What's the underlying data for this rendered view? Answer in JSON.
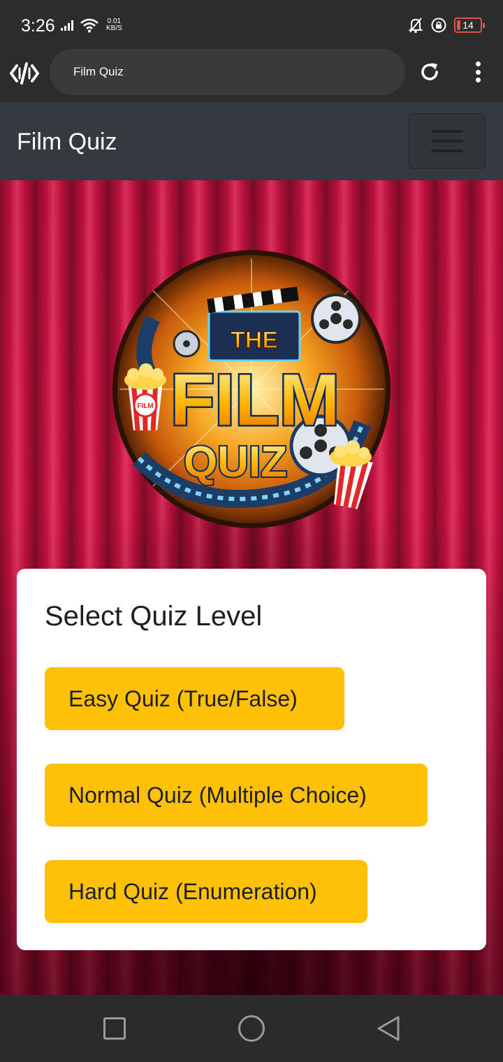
{
  "status_bar": {
    "time": "3:26",
    "net_speed_value": "0.01",
    "net_speed_unit": "KB/S",
    "battery_level": "14",
    "battery_color": "#e05050"
  },
  "browser": {
    "url_text": "Film Quiz",
    "icons": [
      "browser-logo-icon",
      "reload-icon",
      "more-vert-icon"
    ]
  },
  "navbar": {
    "brand": "Film Quiz",
    "toggler_icon": "hamburger-icon"
  },
  "logo": {
    "line_1": "THE",
    "line_2": "FILM",
    "line_3": "QUIZ",
    "popcorn_label": "FILM"
  },
  "card": {
    "title": "Select Quiz Level",
    "buttons": [
      {
        "label": "Easy Quiz (True/False)"
      },
      {
        "label": "Normal Quiz (Multiple Choice)"
      },
      {
        "label": "Hard Quiz (Enumeration)"
      }
    ],
    "button_color": "#ffc107"
  },
  "system_nav": {
    "icons": [
      "recents-square-icon",
      "home-circle-icon",
      "back-triangle-icon"
    ]
  }
}
